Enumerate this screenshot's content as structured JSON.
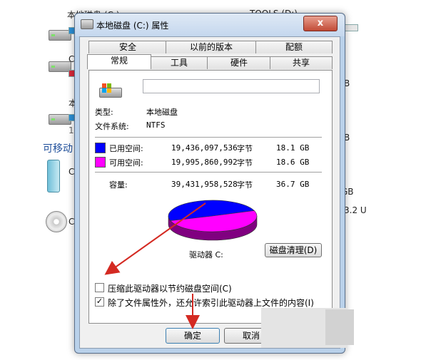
{
  "background": {
    "drive_c_label": "本地磁盘 (C:)",
    "tools_d_label": "TOOLS (D:)",
    "left_letters": [
      "C",
      "本",
      "1",
      "C",
      "C"
    ],
    "removable_header": "可移动",
    "right_fragments": [
      "B",
      "B",
      "GB",
      "3.2 U"
    ],
    "bar_colors": {
      "blue": "#2b8fd6",
      "red": "#d8293a"
    }
  },
  "dialog": {
    "title": "本地磁盘 (C:) 属性",
    "close_glyph": "x",
    "tabs_top": [
      "安全",
      "以前的版本",
      "配额"
    ],
    "tabs_bottom": [
      "常规",
      "工具",
      "硬件",
      "共享"
    ],
    "name_input_value": "",
    "type_label": "类型:",
    "type_value": "本地磁盘",
    "fs_label": "文件系统:",
    "fs_value": "NTFS",
    "used": {
      "label": "已用空间:",
      "bytes": "19,436,097,536",
      "unit": "字节",
      "size": "18.1 GB",
      "color": "#0000ff"
    },
    "free": {
      "label": "可用空间:",
      "bytes": "19,995,860,992",
      "unit": "字节",
      "size": "18.6 GB",
      "color": "#ff00ff"
    },
    "capacity": {
      "label": "容量:",
      "bytes": "39,431,958,528",
      "unit": "字节",
      "size": "36.7 GB"
    },
    "drive_label": "驱动器 C:",
    "cleanup_button": "磁盘清理(D)",
    "compress_checkbox": {
      "label": "压缩此驱动器以节约磁盘空间(C)",
      "checked": false
    },
    "index_checkbox": {
      "label": "除了文件属性外，还允许索引此驱动器上文件的内容(I)",
      "checked": true
    },
    "ok_button": "确定",
    "cancel_button": "取消"
  },
  "pie": {
    "used_fraction": 0.493,
    "free_fraction": 0.507
  },
  "annotation_color": "#d42a22"
}
